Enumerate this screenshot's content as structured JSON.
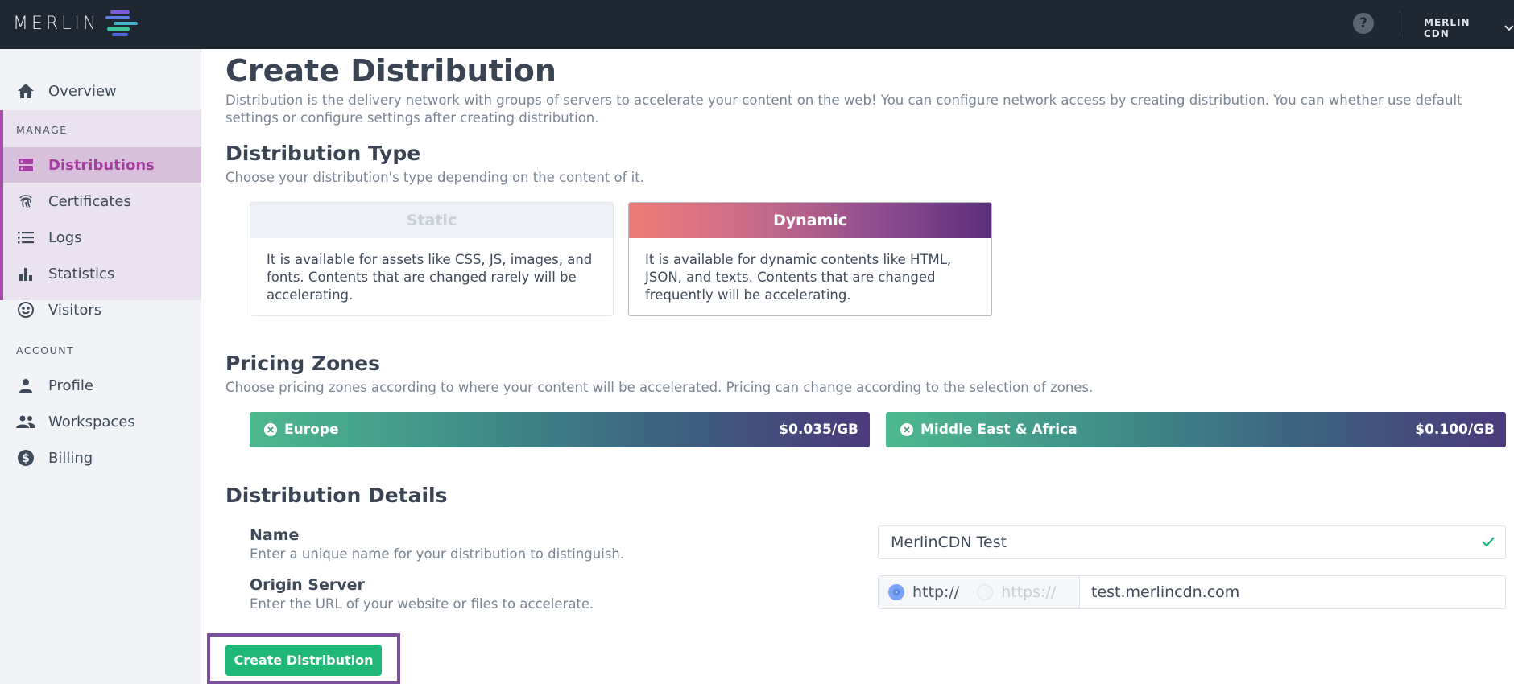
{
  "header": {
    "logo_text": "MERLIN",
    "help_icon": "question-circle-icon",
    "account_label": "MERLIN CDN",
    "colors": {
      "bar": "#1f2733"
    }
  },
  "sidebar": {
    "overview": {
      "label": "Overview",
      "icon": "home-icon"
    },
    "manage_section": "MANAGE",
    "manage_items": [
      {
        "label": "Distributions",
        "icon": "server-icon",
        "active": true
      },
      {
        "label": "Certificates",
        "icon": "fingerprint-icon"
      },
      {
        "label": "Logs",
        "icon": "list-icon"
      },
      {
        "label": "Statistics",
        "icon": "bar-chart-icon"
      },
      {
        "label": "Visitors",
        "icon": "smiley-icon"
      }
    ],
    "account_section": "ACCOUNT",
    "account_items": [
      {
        "label": "Profile",
        "icon": "person-icon"
      },
      {
        "label": "Workspaces",
        "icon": "people-icon"
      },
      {
        "label": "Billing",
        "icon": "dollar-circle-icon"
      }
    ]
  },
  "main": {
    "title": "Create Distribution",
    "description": "Distribution is the delivery network with groups of servers to accelerate your content on the web! You can configure network access by creating distribution. You can whether use default settings or configure settings after creating distribution.",
    "type_section": {
      "title": "Distribution Type",
      "subtitle": "Choose your distribution's type depending on the content of it.",
      "cards": [
        {
          "title": "Static",
          "body": "It is available for assets like CSS, JS, images, and fonts. Contents that are changed rarely will be accelerating.",
          "selected": false
        },
        {
          "title": "Dynamic",
          "body": "It is available for dynamic contents like HTML, JSON, and texts. Contents that are changed frequently will be accelerating.",
          "selected": true
        }
      ]
    },
    "zones_section": {
      "title": "Pricing Zones",
      "subtitle": "Choose pricing zones according to where your content will be accelerated. Pricing can change according to the selection of zones.",
      "zones": [
        {
          "name": "Europe",
          "price": "$0.035/GB"
        },
        {
          "name": "Middle East & Africa",
          "price": "$0.100/GB"
        }
      ]
    },
    "details_section": {
      "title": "Distribution Details",
      "name_label": "Name",
      "name_help": "Enter a unique name for your distribution to distinguish.",
      "name_value": "MerlinCDN Test",
      "origin_label": "Origin Server",
      "origin_help": "Enter the URL of your website or files to accelerate.",
      "protocol_http": "http://",
      "protocol_https": "https://",
      "protocol_selected": "http://",
      "origin_value": "test.merlincdn.com"
    },
    "create_button": "Create Distribution"
  }
}
